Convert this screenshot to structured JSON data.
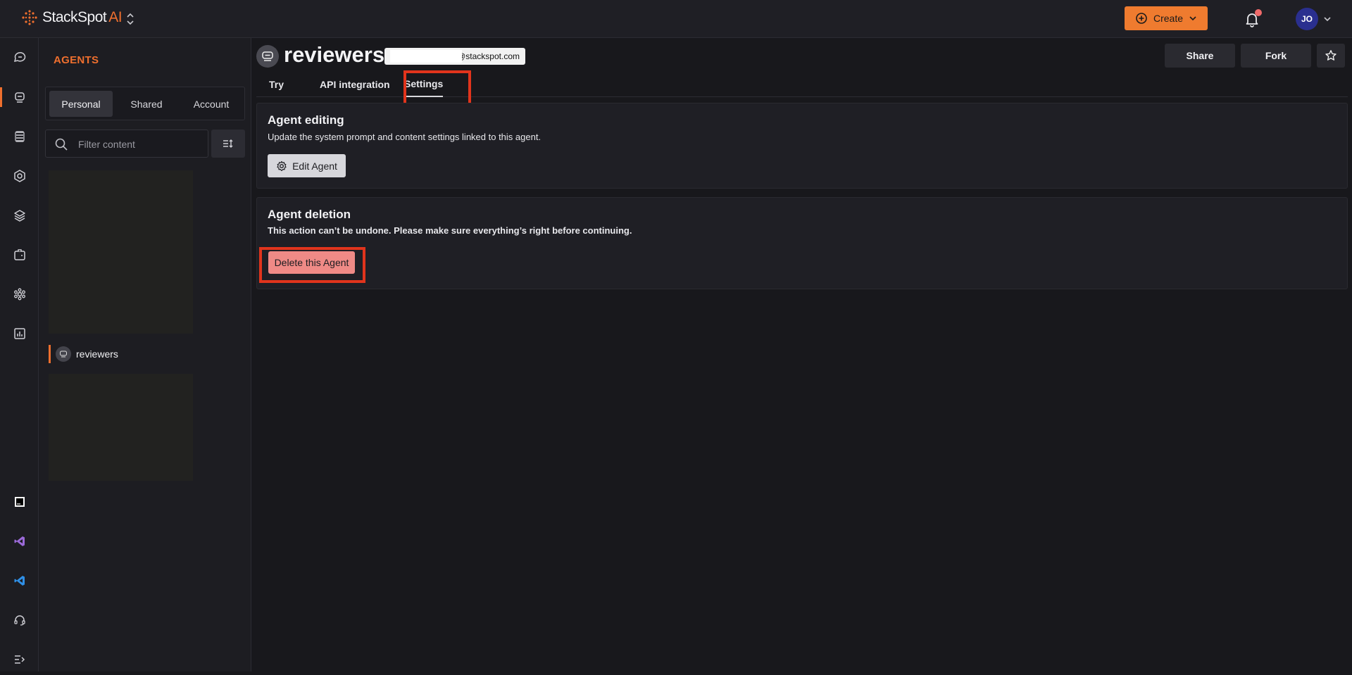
{
  "brand": {
    "name": "StackSpot",
    "suffix": "AI",
    "accent": "#ef6f2e"
  },
  "topbar": {
    "create_label": "Create",
    "avatar_initials": "JO"
  },
  "rail": {
    "items": [
      "chat-icon",
      "agents-icon",
      "knowledge-sources-icon",
      "stacks-icon",
      "layers-icon",
      "quick-commands-icon",
      "settings-icon",
      "analytics-icon"
    ],
    "bottom": [
      "jetbrains-icon",
      "visual-studio-icon",
      "vscode-icon",
      "support-icon",
      "collapse-menu-icon"
    ]
  },
  "panel": {
    "title": "AGENTS",
    "tabs": [
      "Personal",
      "Shared",
      "Account"
    ],
    "active_tab": "Personal",
    "filter_placeholder": "Filter content",
    "selected_agent": "reviewers"
  },
  "agent": {
    "name": "reviewers",
    "owner_email_visible": "a@stackspot.com",
    "share_label": "Share",
    "fork_label": "Fork",
    "tabs": [
      "Try",
      "API integration",
      "Settings"
    ],
    "active_tab": "Settings"
  },
  "settings": {
    "editing": {
      "title": "Agent editing",
      "description": "Update the system prompt and content settings linked to this agent.",
      "button": "Edit Agent"
    },
    "deletion": {
      "title": "Agent deletion",
      "description": "This action can’t be undone. Please make sure everything’s right before continuing.",
      "button": "Delete this Agent"
    }
  },
  "highlight_color": "#e1341c"
}
